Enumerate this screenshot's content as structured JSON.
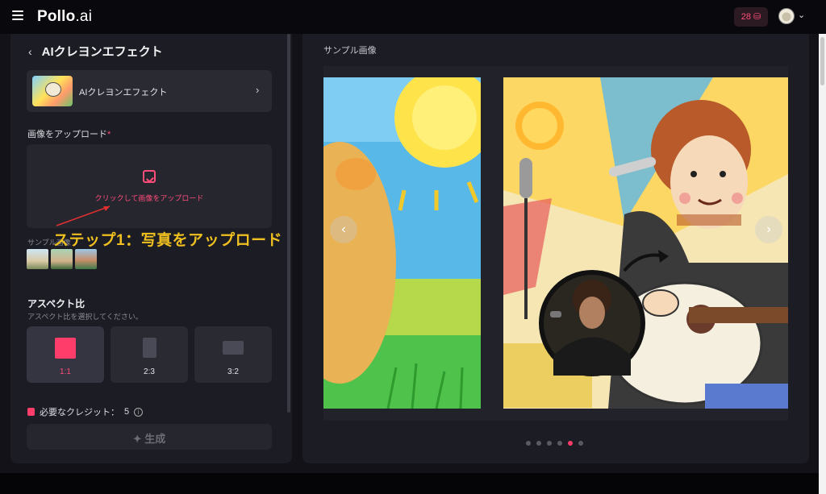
{
  "header": {
    "logo_main": "Pollo",
    "logo_suffix": ".ai",
    "credits": "28 ⛁",
    "menu_icon": "hamburger-icon",
    "avatar_icon": "avatar",
    "avatar_menu_icon": "chevron-down-icon"
  },
  "left_panel": {
    "back_icon": "chevron-left-icon",
    "title": "AIクレヨンエフェクト",
    "effect_card": {
      "name": "AIクレヨンエフェクト",
      "chevron": "›"
    },
    "upload": {
      "label": "画像をアップロード",
      "required_mark": "*",
      "prompt": "クリックして画像をアップロード",
      "icon": "image-plus-icon"
    },
    "sample_label": "サンプル画像",
    "annotation": "ステップ1：写真をアップロード",
    "aspect": {
      "title": "アスペクト比",
      "subtitle": "アスペクト比を選択してください。",
      "options": [
        {
          "label": "1:1",
          "active": true
        },
        {
          "label": "2:3",
          "active": false
        },
        {
          "label": "3:2",
          "active": false
        }
      ]
    },
    "credit_required": "必要なクレジット：",
    "credit_value": "5",
    "info_glyph": "i",
    "generate": {
      "label": "生成",
      "icon": "sparkle-icon"
    }
  },
  "right_panel": {
    "title": "サンプル画像",
    "nav_prev": "‹",
    "nav_next": "›",
    "dots": [
      false,
      false,
      false,
      false,
      true,
      false
    ]
  },
  "colors": {
    "accent": "#ff3d6a",
    "panel": "#1c1c24",
    "background": "#121218",
    "annotation": "#f0c020"
  }
}
